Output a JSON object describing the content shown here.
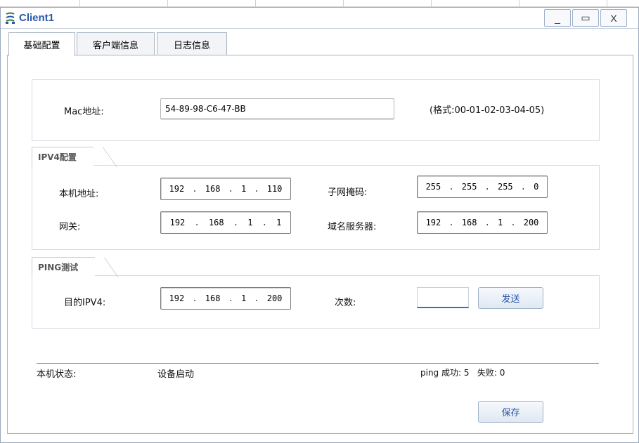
{
  "window": {
    "title": "Client1",
    "minimize_label": "_",
    "maximize_label": "▭",
    "close_label": "X"
  },
  "tabs": [
    {
      "label": "基础配置"
    },
    {
      "label": "客户端信息"
    },
    {
      "label": "日志信息"
    }
  ],
  "mac": {
    "label": "Mac地址:",
    "value": "54-89-98-C6-47-BB",
    "format_hint": "(格式:00-01-02-03-04-05)"
  },
  "ipv4": {
    "section_title": "IPV4配置",
    "local_address_label": "本机地址:",
    "local_address": [
      "192",
      "168",
      "1",
      "110"
    ],
    "subnet_mask_label": "子网掩码:",
    "subnet_mask": [
      "255",
      "255",
      "255",
      "0"
    ],
    "gateway_label": "网关:",
    "gateway": [
      "192",
      "168",
      "1",
      "1"
    ],
    "dns_label": "域名服务器:",
    "dns": [
      "192",
      "168",
      "1",
      "200"
    ]
  },
  "ping": {
    "section_title": "PING测试",
    "dest_label": "目的IPV4:",
    "dest": [
      "192",
      "168",
      "1",
      "200"
    ],
    "count_label": "次数:",
    "count_value": "",
    "send_label": "发送"
  },
  "status": {
    "label": "本机状态:",
    "value": "设备启动",
    "ping_summary": "ping 成功: 5   失败: 0"
  },
  "save_label": "保存",
  "colors": {
    "title_blue": "#2a5aa8",
    "button_text": "#2b55a6",
    "input_underline": "#3a6fb5"
  }
}
